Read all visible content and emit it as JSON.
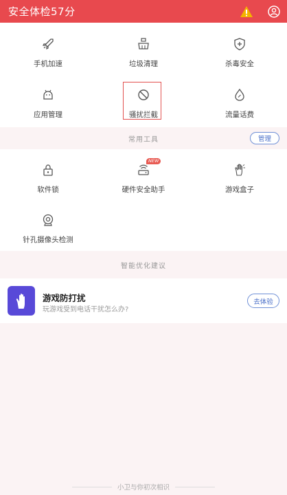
{
  "header": {
    "title": "安全体检57分",
    "warning_icon": "warning-triangle-icon",
    "user_icon": "user-circle-icon",
    "accent_color": "#e8494e"
  },
  "main_tools": [
    {
      "label": "手机加速",
      "icon": "rocket-icon"
    },
    {
      "label": "垃圾清理",
      "icon": "broom-icon"
    },
    {
      "label": "杀毒安全",
      "icon": "shield-plus-icon"
    },
    {
      "label": "应用管理",
      "icon": "android-icon"
    },
    {
      "label": "骚扰拦截",
      "icon": "block-circle-icon"
    },
    {
      "label": "流量话费",
      "icon": "drop-icon"
    }
  ],
  "common_tools": {
    "section_label": "常用工具",
    "manage_label": "管理",
    "new_badge": "NEW",
    "items": [
      {
        "label": "软件锁",
        "icon": "lock-icon"
      },
      {
        "label": "硬件安全助手",
        "icon": "hardware-router-icon"
      },
      {
        "label": "游戏盒子",
        "icon": "game-hand-icon"
      },
      {
        "label": "针孔摄像头检测",
        "icon": "camera-detect-icon"
      }
    ]
  },
  "suggestions": {
    "section_label": "智能优化建议",
    "card": {
      "title": "游戏防打扰",
      "subtitle": "玩游戏受到电话干扰怎么办?",
      "button": "去体验",
      "icon": "hand-icon",
      "icon_color": "#5849d8"
    }
  },
  "footer": {
    "text": "小卫与你初次相识"
  }
}
